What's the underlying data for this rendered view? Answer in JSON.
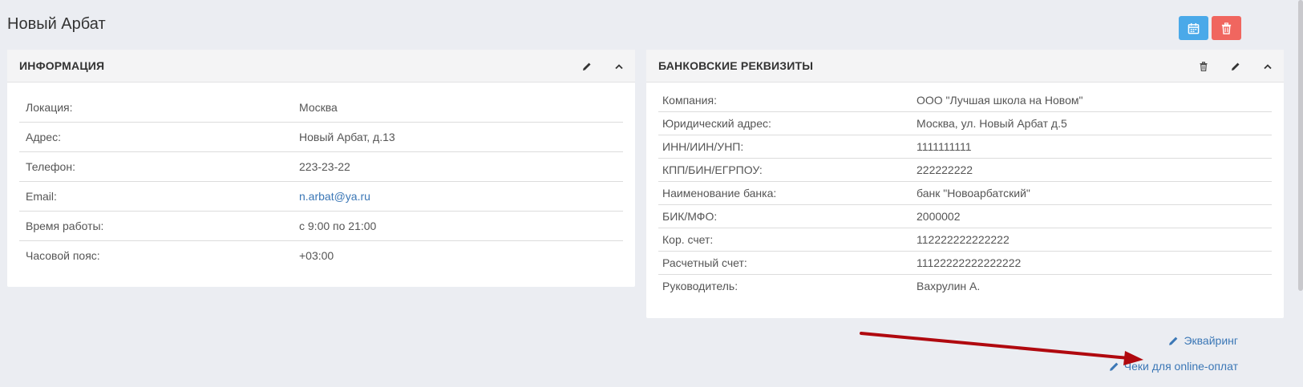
{
  "page": {
    "title": "Новый Арбат"
  },
  "colors": {
    "calendar_button": "#4aa9e9",
    "delete_button": "#f0665f",
    "link": "#3b77b6",
    "arrow": "#b0090f"
  },
  "info_panel": {
    "title": "ИНФОРМАЦИЯ",
    "rows": [
      {
        "label": "Локация:",
        "value": "Москва"
      },
      {
        "label": "Адрес:",
        "value": "Новый Арбат, д.13"
      },
      {
        "label": "Телефон:",
        "value": "223-23-22"
      },
      {
        "label": "Email:",
        "value": "n.arbat@ya.ru"
      },
      {
        "label": "Время работы:",
        "value": "с 9:00 по 21:00"
      },
      {
        "label": "Часовой пояс:",
        "value": "+03:00"
      }
    ]
  },
  "bank_panel": {
    "title": "БАНКОВСКИЕ РЕКВИЗИТЫ",
    "rows": [
      {
        "label": "Компания:",
        "value": "ООО \"Лучшая школа на Новом\""
      },
      {
        "label": "Юридический адрес:",
        "value": "Москва, ул. Новый Арбат д.5"
      },
      {
        "label": "ИНН/ИИН/УНП:",
        "value": "1111111111"
      },
      {
        "label": "КПП/БИН/ЕГРПОУ:",
        "value": "222222222"
      },
      {
        "label": "Наименование банка:",
        "value": "банк \"Новоарбатский\""
      },
      {
        "label": "БИК/МФО:",
        "value": "2000002"
      },
      {
        "label": "Кор. счет:",
        "value": "112222222222222"
      },
      {
        "label": "Расчетный счет:",
        "value": "11122222222222222"
      },
      {
        "label": "Руководитель:",
        "value": "Вахрулин А."
      }
    ]
  },
  "links": {
    "acquiring": "Эквайринг",
    "online_receipts": "Чеки для online-оплат"
  }
}
